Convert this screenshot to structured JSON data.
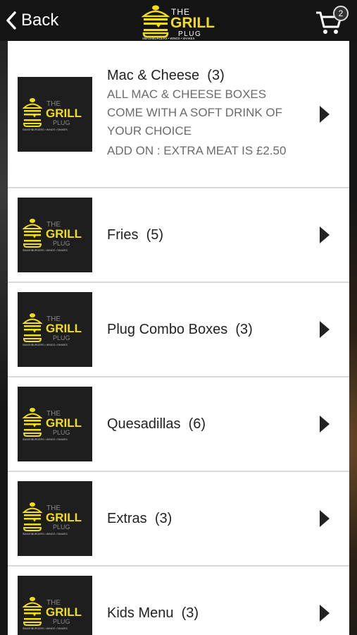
{
  "header": {
    "back_label": "Back",
    "logo": {
      "the": "THE",
      "grill": "GRILL",
      "plug": "PLUG",
      "tagline": "SMASHBURGERS • WINGS • SHAKES"
    },
    "cart_count": "2"
  },
  "categories": [
    {
      "name": "Mac & Cheese",
      "count": "(3)",
      "desc1": "ALL MAC & CHEESE BOXES COME WITH A SOFT DRINK OF YOUR CHOICE",
      "desc2": "ADD ON : EXTRA MEAT IS £2.50"
    },
    {
      "name": "Fries",
      "count": "(5)"
    },
    {
      "name": "Plug Combo Boxes",
      "count": "(3)"
    },
    {
      "name": "Quesadillas",
      "count": "(6)"
    },
    {
      "name": "Extras",
      "count": "(3)"
    },
    {
      "name": "Kids Menu",
      "count": "(3)"
    }
  ],
  "colors": {
    "brand_yellow": "#f2dd1d"
  }
}
